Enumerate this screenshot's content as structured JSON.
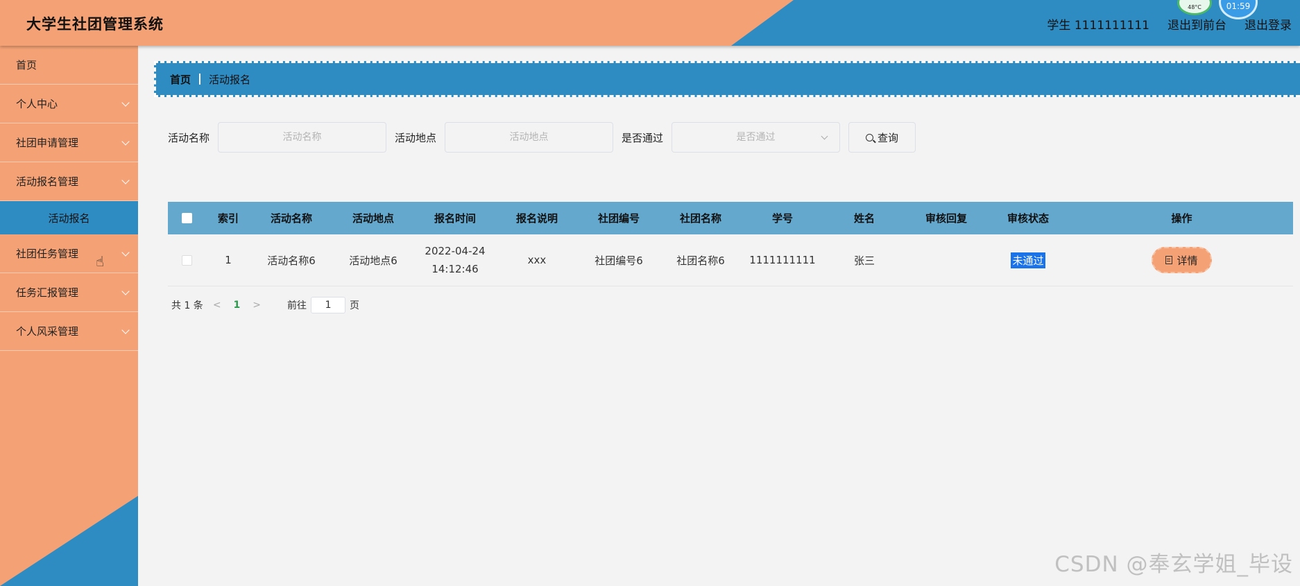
{
  "header": {
    "title": "大学生社团管理系统",
    "user": "学生 1111111111",
    "front_link": "退出到前台",
    "logout_link": "退出登录",
    "temp_widget": "48°C",
    "clock_widget": "01:59"
  },
  "sidebar": {
    "items": [
      {
        "label": "首页",
        "has_arrow": false
      },
      {
        "label": "个人中心",
        "has_arrow": true
      },
      {
        "label": "社团申请管理",
        "has_arrow": true
      },
      {
        "label": "活动报名管理",
        "has_arrow": true
      },
      {
        "label": "社团任务管理",
        "has_arrow": true
      },
      {
        "label": "任务汇报管理",
        "has_arrow": true
      },
      {
        "label": "个人风采管理",
        "has_arrow": true
      }
    ],
    "active_sub": "活动报名"
  },
  "breadcrumb": {
    "home": "首页",
    "current": "活动报名"
  },
  "search": {
    "name_label": "活动名称",
    "name_placeholder": "活动名称",
    "location_label": "活动地点",
    "location_placeholder": "活动地点",
    "passed_label": "是否通过",
    "passed_placeholder": "是否通过",
    "button_label": "查询"
  },
  "table": {
    "columns": [
      "索引",
      "活动名称",
      "活动地点",
      "报名时间",
      "报名说明",
      "社团编号",
      "社团名称",
      "学号",
      "姓名",
      "审核回复",
      "审核状态",
      "操作"
    ],
    "rows": [
      {
        "index": "1",
        "activity_name": "活动名称6",
        "location": "活动地点6",
        "date": "2022-04-24",
        "time": "14:12:46",
        "description": "xxx",
        "club_no": "社团编号6",
        "club_name": "社团名称6",
        "student_no": "1111111111",
        "student_name": "张三",
        "reply": "",
        "status": "未通过",
        "action": "详情"
      }
    ]
  },
  "pagination": {
    "total": "共 1 条",
    "current_page": "1",
    "goto_label": "前往",
    "goto_value": "1",
    "page_suffix": "页"
  },
  "watermark": "CSDN @奉玄学姐_毕设",
  "colors": {
    "orange": "#f4a275",
    "blue": "#2e8cc2",
    "table_header": "#64a8ce",
    "status_tag": "#1a73e8"
  }
}
